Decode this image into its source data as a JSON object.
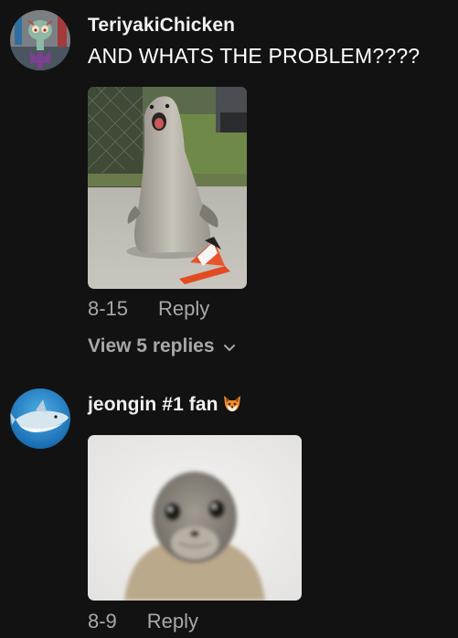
{
  "comments": [
    {
      "username": "TeriyakiChicken",
      "text": "AND WHATS THE PROBLEM????",
      "media": "seal-with-traffic-cone",
      "avatar": "squidward-avatar",
      "date": "8-15",
      "reply_label": "Reply",
      "view_replies_label": "View 5 replies"
    },
    {
      "username": "jeongin #1 fan",
      "username_emoji": "fox-emoji",
      "media": "seal-pup-closeup",
      "avatar": "shark-avatar",
      "date": "8-9",
      "reply_label": "Reply"
    }
  ],
  "colors": {
    "background": "#121212",
    "username": "#f1f1f1",
    "secondary_text": "#a8a8a8"
  }
}
